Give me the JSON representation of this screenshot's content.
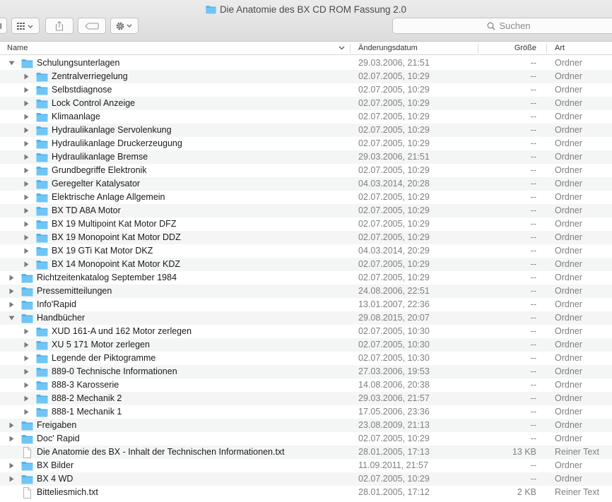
{
  "window": {
    "title": "Die Anatomie des BX CD ROM Fassung 2.0",
    "folder_color": "#4fb3ec"
  },
  "toolbar": {
    "view_icon": "columns-view-icon",
    "grid_icon": "icon-grid-icon",
    "share_icon": "share-icon",
    "tag_icon": "tag-icon",
    "action_icon": "gear-icon",
    "search_placeholder": "Suchen"
  },
  "columns": {
    "name": "Name",
    "date": "Änderungsdatum",
    "size": "Größe",
    "kind": "Art"
  },
  "rows": [
    {
      "level": 0,
      "expanded": true,
      "type": "folder",
      "name": "Schulungsunterlagen",
      "date": "29.03.2006, 21:51",
      "size": "--",
      "kind": "Ordner"
    },
    {
      "level": 1,
      "expanded": false,
      "type": "folder",
      "name": "Zentralverriegelung",
      "date": "02.07.2005, 10:29",
      "size": "--",
      "kind": "Ordner"
    },
    {
      "level": 1,
      "expanded": false,
      "type": "folder",
      "name": "Selbstdiagnose",
      "date": "02.07.2005, 10:29",
      "size": "--",
      "kind": "Ordner"
    },
    {
      "level": 1,
      "expanded": false,
      "type": "folder",
      "name": "Lock Control Anzeige",
      "date": "02.07.2005, 10:29",
      "size": "--",
      "kind": "Ordner"
    },
    {
      "level": 1,
      "expanded": false,
      "type": "folder",
      "name": "Klimaanlage",
      "date": "02.07.2005, 10:29",
      "size": "--",
      "kind": "Ordner"
    },
    {
      "level": 1,
      "expanded": false,
      "type": "folder",
      "name": "Hydraulikanlage Servolenkung",
      "date": "02.07.2005, 10:29",
      "size": "--",
      "kind": "Ordner"
    },
    {
      "level": 1,
      "expanded": false,
      "type": "folder",
      "name": "Hydraulikanlage Druckerzeugung",
      "date": "02.07.2005, 10:29",
      "size": "--",
      "kind": "Ordner"
    },
    {
      "level": 1,
      "expanded": false,
      "type": "folder",
      "name": "Hydraulikanlage Bremse",
      "date": "29.03.2006, 21:51",
      "size": "--",
      "kind": "Ordner"
    },
    {
      "level": 1,
      "expanded": false,
      "type": "folder",
      "name": "Grundbegriffe Elektronik",
      "date": "02.07.2005, 10:29",
      "size": "--",
      "kind": "Ordner"
    },
    {
      "level": 1,
      "expanded": false,
      "type": "folder",
      "name": "Geregelter Katalysator",
      "date": "04.03.2014, 20:28",
      "size": "--",
      "kind": "Ordner"
    },
    {
      "level": 1,
      "expanded": false,
      "type": "folder",
      "name": "Elektrische Anlage Allgemein",
      "date": "02.07.2005, 10:29",
      "size": "--",
      "kind": "Ordner"
    },
    {
      "level": 1,
      "expanded": false,
      "type": "folder",
      "name": "BX TD A8A Motor",
      "date": "02.07.2005, 10:29",
      "size": "--",
      "kind": "Ordner"
    },
    {
      "level": 1,
      "expanded": false,
      "type": "folder",
      "name": "BX 19 Multipoint Kat Motor DFZ",
      "date": "02.07.2005, 10:29",
      "size": "--",
      "kind": "Ordner"
    },
    {
      "level": 1,
      "expanded": false,
      "type": "folder",
      "name": "BX 19 Monopoint Kat Motor DDZ",
      "date": "02.07.2005, 10:29",
      "size": "--",
      "kind": "Ordner"
    },
    {
      "level": 1,
      "expanded": false,
      "type": "folder",
      "name": "BX 19 GTi Kat Motor DKZ",
      "date": "04.03.2014, 20:29",
      "size": "--",
      "kind": "Ordner"
    },
    {
      "level": 1,
      "expanded": false,
      "type": "folder",
      "name": "BX 14 Monopoint Kat Motor KDZ",
      "date": "02.07.2005, 10:29",
      "size": "--",
      "kind": "Ordner"
    },
    {
      "level": 0,
      "expanded": false,
      "type": "folder",
      "name": "Richtzeitenkatalog September 1984",
      "date": "02.07.2005, 10:29",
      "size": "--",
      "kind": "Ordner"
    },
    {
      "level": 0,
      "expanded": false,
      "type": "folder",
      "name": "Pressemitteilungen",
      "date": "24.08.2006, 22:51",
      "size": "--",
      "kind": "Ordner"
    },
    {
      "level": 0,
      "expanded": false,
      "type": "folder",
      "name": "Info'Rapid",
      "date": "13.01.2007, 22:36",
      "size": "--",
      "kind": "Ordner"
    },
    {
      "level": 0,
      "expanded": true,
      "type": "folder",
      "name": "Handbücher",
      "date": "29.08.2015, 20:07",
      "size": "--",
      "kind": "Ordner"
    },
    {
      "level": 1,
      "expanded": false,
      "type": "folder",
      "name": "XUD 161-A und 162 Motor zerlegen",
      "date": "02.07.2005, 10:30",
      "size": "--",
      "kind": "Ordner"
    },
    {
      "level": 1,
      "expanded": false,
      "type": "folder",
      "name": "XU 5 171 Motor zerlegen",
      "date": "02.07.2005, 10:30",
      "size": "--",
      "kind": "Ordner"
    },
    {
      "level": 1,
      "expanded": false,
      "type": "folder",
      "name": "Legende der Piktogramme",
      "date": "02.07.2005, 10:30",
      "size": "--",
      "kind": "Ordner"
    },
    {
      "level": 1,
      "expanded": false,
      "type": "folder",
      "name": "889-0 Technische Informationen",
      "date": "27.03.2006, 19:53",
      "size": "--",
      "kind": "Ordner"
    },
    {
      "level": 1,
      "expanded": false,
      "type": "folder",
      "name": "888-3 Karosserie",
      "date": "14.08.2006, 20:38",
      "size": "--",
      "kind": "Ordner"
    },
    {
      "level": 1,
      "expanded": false,
      "type": "folder",
      "name": "888-2 Mechanik 2",
      "date": "29.03.2006, 21:57",
      "size": "--",
      "kind": "Ordner"
    },
    {
      "level": 1,
      "expanded": false,
      "type": "folder",
      "name": "888-1 Mechanik 1",
      "date": "17.05.2006, 23:36",
      "size": "--",
      "kind": "Ordner"
    },
    {
      "level": 0,
      "expanded": false,
      "type": "folder",
      "name": "Freigaben",
      "date": "23.08.2009, 21:13",
      "size": "--",
      "kind": "Ordner"
    },
    {
      "level": 0,
      "expanded": false,
      "type": "folder",
      "name": "Doc' Rapid",
      "date": "02.07.2005, 10:29",
      "size": "--",
      "kind": "Ordner"
    },
    {
      "level": 0,
      "expanded": false,
      "type": "file",
      "name": "Die Anatomie des BX - Inhalt der Technischen Informationen.txt",
      "date": "28.01.2005, 17:13",
      "size": "13 KB",
      "kind": "Reiner Text"
    },
    {
      "level": 0,
      "expanded": false,
      "type": "folder",
      "name": "BX Bilder",
      "date": "11.09.2011, 21:57",
      "size": "--",
      "kind": "Ordner"
    },
    {
      "level": 0,
      "expanded": false,
      "type": "folder",
      "name": "BX 4 WD",
      "date": "02.07.2005, 10:29",
      "size": "--",
      "kind": "Ordner"
    },
    {
      "level": 0,
      "expanded": false,
      "type": "file",
      "name": "Bitteliesmich.txt",
      "date": "28.01.2005, 17:12",
      "size": "2 KB",
      "kind": "Reiner Text"
    }
  ]
}
